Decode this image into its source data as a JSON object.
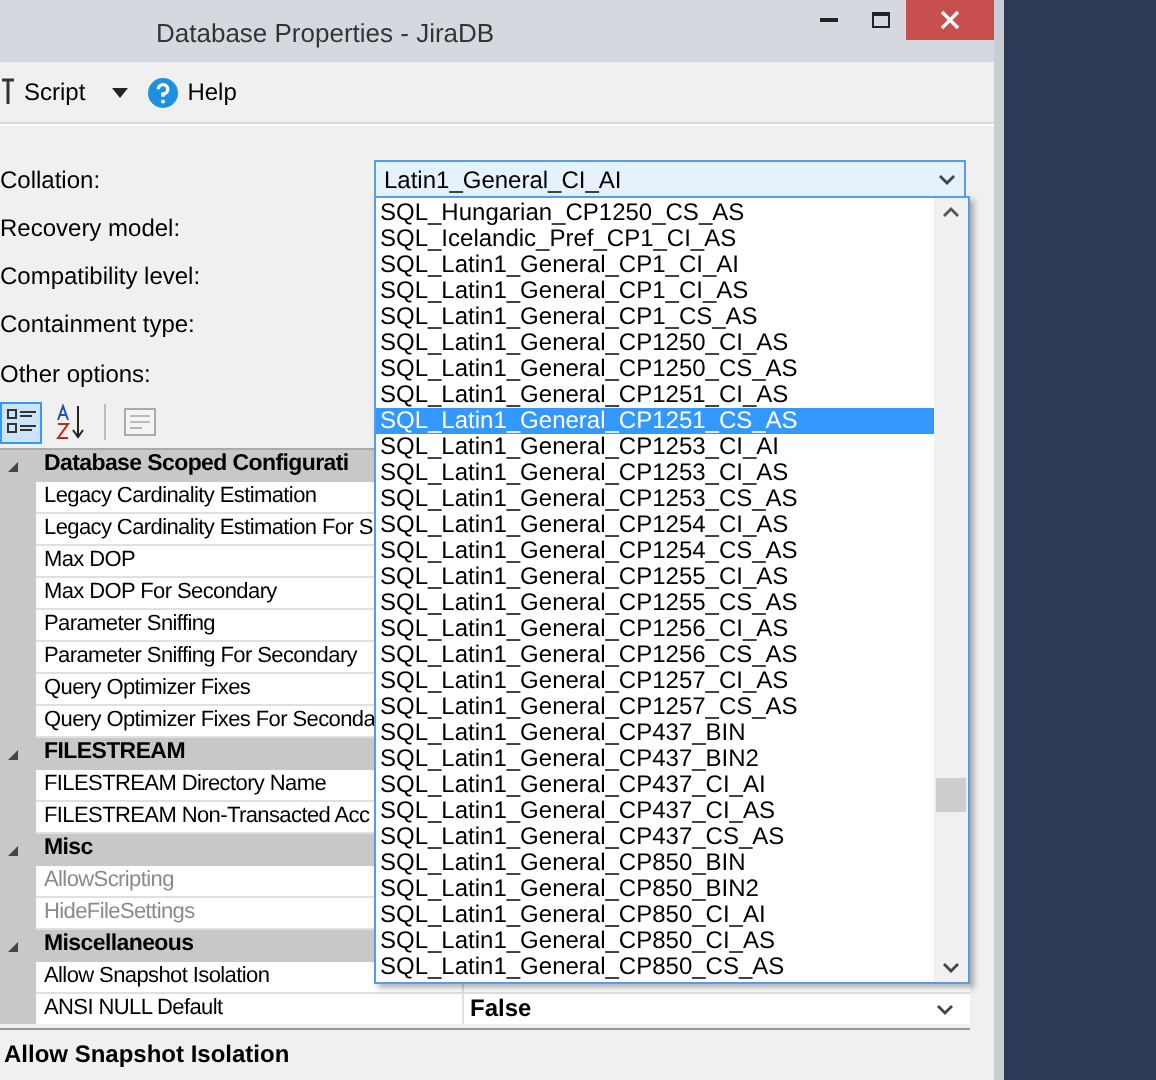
{
  "window": {
    "title": "Database Properties - JiraDB"
  },
  "toolbar": [
    {
      "kind": "script",
      "label": "Script"
    },
    {
      "kind": "help",
      "label": "Help"
    }
  ],
  "fields": [
    {
      "label": "Collation:",
      "value": "Latin1_General_CI_AI"
    },
    {
      "label": "Recovery model:"
    },
    {
      "label": "Compatibility level:"
    },
    {
      "label": "Containment type:"
    },
    {
      "label": "Other options:"
    }
  ],
  "grid_toolbar": [
    {
      "kind": "categorized",
      "selected": true
    },
    {
      "kind": "alphabetical",
      "selected": false
    },
    {
      "kind": "pages",
      "selected": false
    }
  ],
  "property_grid": [
    {
      "category": "Database Scoped Configurati",
      "expanded": true,
      "rows": [
        {
          "name": "Legacy Cardinality Estimation",
          "disabled": false
        },
        {
          "name": "Legacy Cardinality Estimation For S",
          "disabled": false
        },
        {
          "name": "Max DOP",
          "disabled": false
        },
        {
          "name": "Max DOP For Secondary",
          "disabled": false
        },
        {
          "name": "Parameter Sniffing",
          "disabled": false
        },
        {
          "name": "Parameter Sniffing For Secondary",
          "disabled": false
        },
        {
          "name": "Query Optimizer Fixes",
          "disabled": false
        },
        {
          "name": "Query Optimizer Fixes For Seconda",
          "disabled": false
        }
      ]
    },
    {
      "category": "FILESTREAM",
      "expanded": true,
      "rows": [
        {
          "name": "FILESTREAM Directory Name",
          "disabled": false
        },
        {
          "name": "FILESTREAM Non-Transacted Acc",
          "disabled": false
        }
      ]
    },
    {
      "category": "Misc",
      "expanded": true,
      "rows": [
        {
          "name": "AllowScripting",
          "disabled": true
        },
        {
          "name": "HideFileSettings",
          "disabled": true
        }
      ]
    },
    {
      "category": "Miscellaneous",
      "expanded": true,
      "rows": [
        {
          "name": "Allow Snapshot Isolation",
          "disabled": false
        },
        {
          "name": "ANSI NULL Default",
          "value": "False",
          "disabled": false
        }
      ]
    }
  ],
  "description": "Allow Snapshot Isolation",
  "collation_dropdown": [
    {
      "label": "SQL_Hungarian_CP1250_CS_AS",
      "selected": false
    },
    {
      "label": "SQL_Icelandic_Pref_CP1_CI_AS",
      "selected": false
    },
    {
      "label": "SQL_Latin1_General_CP1_CI_AI",
      "selected": false
    },
    {
      "label": "SQL_Latin1_General_CP1_CI_AS",
      "selected": false
    },
    {
      "label": "SQL_Latin1_General_CP1_CS_AS",
      "selected": false
    },
    {
      "label": "SQL_Latin1_General_CP1250_CI_AS",
      "selected": false
    },
    {
      "label": "SQL_Latin1_General_CP1250_CS_AS",
      "selected": false
    },
    {
      "label": "SQL_Latin1_General_CP1251_CI_AS",
      "selected": false
    },
    {
      "label": "SQL_Latin1_General_CP1251_CS_AS",
      "selected": true
    },
    {
      "label": "SQL_Latin1_General_CP1253_CI_AI",
      "selected": false
    },
    {
      "label": "SQL_Latin1_General_CP1253_CI_AS",
      "selected": false
    },
    {
      "label": "SQL_Latin1_General_CP1253_CS_AS",
      "selected": false
    },
    {
      "label": "SQL_Latin1_General_CP1254_CI_AS",
      "selected": false
    },
    {
      "label": "SQL_Latin1_General_CP1254_CS_AS",
      "selected": false
    },
    {
      "label": "SQL_Latin1_General_CP1255_CI_AS",
      "selected": false
    },
    {
      "label": "SQL_Latin1_General_CP1255_CS_AS",
      "selected": false
    },
    {
      "label": "SQL_Latin1_General_CP1256_CI_AS",
      "selected": false
    },
    {
      "label": "SQL_Latin1_General_CP1256_CS_AS",
      "selected": false
    },
    {
      "label": "SQL_Latin1_General_CP1257_CI_AS",
      "selected": false
    },
    {
      "label": "SQL_Latin1_General_CP1257_CS_AS",
      "selected": false
    },
    {
      "label": "SQL_Latin1_General_CP437_BIN",
      "selected": false
    },
    {
      "label": "SQL_Latin1_General_CP437_BIN2",
      "selected": false
    },
    {
      "label": "SQL_Latin1_General_CP437_CI_AI",
      "selected": false
    },
    {
      "label": "SQL_Latin1_General_CP437_CI_AS",
      "selected": false
    },
    {
      "label": "SQL_Latin1_General_CP437_CS_AS",
      "selected": false
    },
    {
      "label": "SQL_Latin1_General_CP850_BIN",
      "selected": false
    },
    {
      "label": "SQL_Latin1_General_CP850_BIN2",
      "selected": false
    },
    {
      "label": "SQL_Latin1_General_CP850_CI_AI",
      "selected": false
    },
    {
      "label": "SQL_Latin1_General_CP850_CI_AS",
      "selected": false
    },
    {
      "label": "SQL_Latin1_General_CP850_CS_AS",
      "selected": false
    }
  ]
}
